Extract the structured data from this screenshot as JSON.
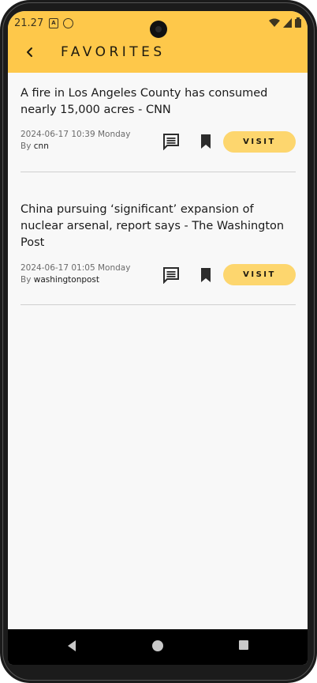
{
  "status_bar": {
    "time": "21.27"
  },
  "header": {
    "title": "FAVORITES"
  },
  "articles": [
    {
      "title": "A fire in Los Angeles County has consumed nearly 15,000 acres - CNN",
      "date": "2024-06-17 10:39 Monday",
      "by_prefix": "By",
      "source": "cnn",
      "visit_label": "VISIT"
    },
    {
      "title": "China pursuing ‘significant’ expansion of nuclear arsenal, report says - The Washington Post",
      "date": "2024-06-17 01:05 Monday",
      "by_prefix": "By",
      "source": "washingtonpost",
      "visit_label": "VISIT"
    }
  ],
  "colors": {
    "header_bg": "#fec84a",
    "visit_bg": "#fdd66e",
    "screen_bg": "#f8f8f8"
  },
  "icons": [
    "back-arrow-icon",
    "comment-icon",
    "bookmark-icon",
    "wifi-icon",
    "signal-icon",
    "battery-icon"
  ]
}
